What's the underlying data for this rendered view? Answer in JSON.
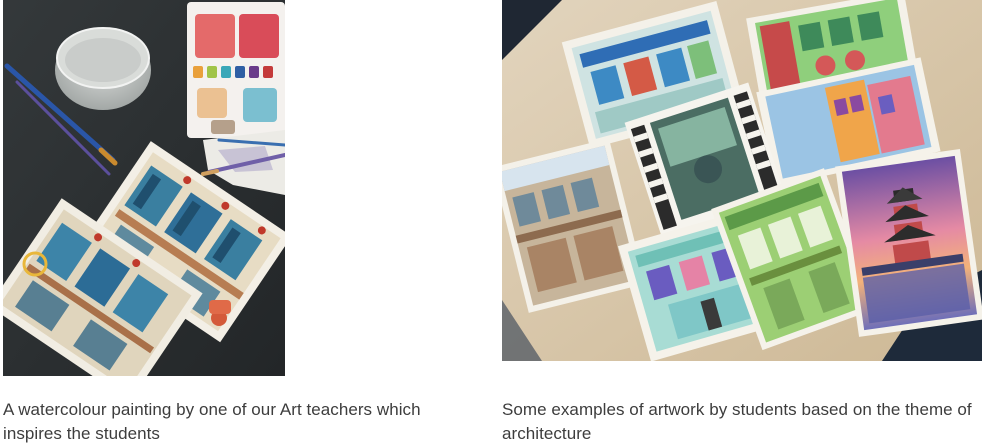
{
  "figures": [
    {
      "photo_name": "watercolour-painting-photo",
      "caption": "A watercolour painting by one of our Art teachers which inspires the students"
    },
    {
      "photo_name": "student-artwork-photo",
      "caption": "Some examples of artwork by students based on the theme of architecture"
    }
  ]
}
